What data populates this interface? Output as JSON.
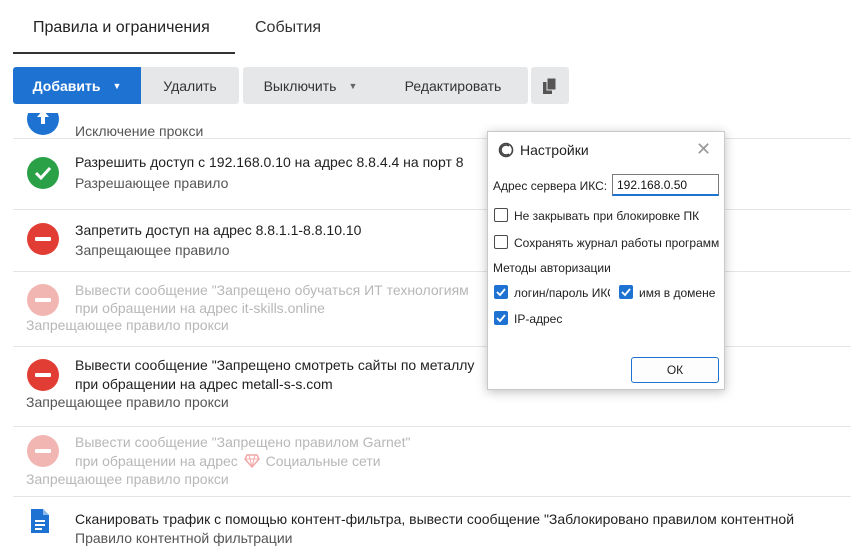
{
  "tabs": {
    "active": "Правила и ограничения",
    "inactive": "События"
  },
  "toolbar": {
    "add": "Добавить",
    "delete": "Удалить",
    "disable": "Выключить",
    "edit": "Редактировать"
  },
  "rules": [
    {
      "title": "",
      "subtitle": "Исключение прокси",
      "icon": "arrow-up-icon",
      "color": "#1e73d2"
    },
    {
      "title": "Разрешить доступ с 192.168.0.10 на адрес 8.8.4.4 на порт 8",
      "subtitle": "Разрешающее правило",
      "icon": "check-icon",
      "color": "#2aa147"
    },
    {
      "title": "Запретить доступ на адрес 8.8.1.1-8.8.10.10",
      "subtitle": "Запрещающее правило",
      "icon": "minus-icon",
      "color": "#e23d35"
    },
    {
      "title": "Вывести сообщение \"Запрещено обучаться ИТ технологиям",
      "line2": "при обращении на адрес it-skills.online",
      "subtitle": "Запрещающее правило прокси",
      "icon": "minus-icon",
      "disabled": true
    },
    {
      "title": "Вывести сообщение \"Запрещено смотреть сайты по металлу",
      "line2": "при обращении на адрес metall-s-s.com",
      "subtitle": "Запрещающее правило прокси",
      "icon": "minus-icon",
      "color": "#e23d35"
    },
    {
      "title": "Вывести сообщение \"Запрещено правилом Garnet\"",
      "line2": "при обращении на адрес",
      "line2b": "Социальные сети",
      "subtitle": "Запрещающее правило прокси",
      "icon": "minus-icon",
      "disabled": true
    },
    {
      "title": "Сканировать трафик с помощью контент-фильтра, вывести сообщение \"Заблокировано правилом контентной",
      "subtitle": "Правило контентной фильтрации",
      "icon": "document-icon",
      "color": "#1e73d2"
    }
  ],
  "dialog": {
    "title": "Настройки",
    "server_label": "Адрес сервера ИКС:",
    "server_value": "192.168.0.50",
    "opt_no_close": "Не закрывать при блокировке ПК",
    "opt_log": "Сохранять журнал работы программы",
    "auth_methods": "Методы авторизации",
    "auth_login": "логин/пароль ИКС",
    "auth_domain": "имя в домене",
    "auth_ip": "IP-адрес",
    "ok": "ОК",
    "checks": {
      "no_close": false,
      "log": false,
      "login": true,
      "domain": true,
      "ip": true
    }
  }
}
